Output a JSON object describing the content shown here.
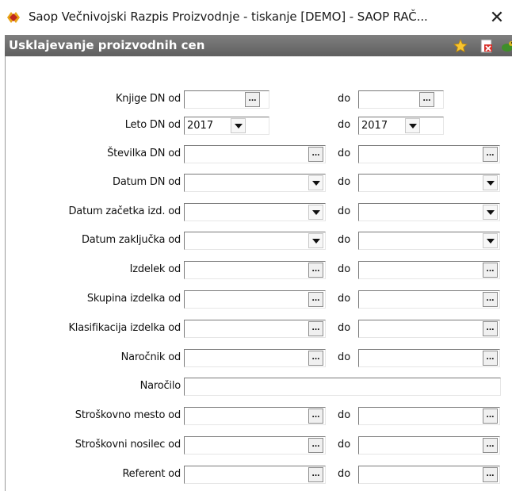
{
  "window": {
    "title": "Saop  Večnivojski Razpis Proizvodnje - tiskanje [DEMO] - SAOP RAČ...",
    "close_glyph": "✕"
  },
  "banner": {
    "title": "Usklajevanje proizvodnih cen",
    "icons": [
      "favorite-star-icon",
      "close-document-icon",
      "exit-turtle-icon"
    ]
  },
  "form": {
    "do_label": "do",
    "rows": [
      {
        "key": "knjige_dn",
        "label": "Knjige DN od",
        "from": "",
        "to": ""
      },
      {
        "key": "leto_dn",
        "label": "Leto DN od",
        "from": "2017",
        "to": "2017"
      },
      {
        "key": "stevilka_dn",
        "label": "Številka DN od",
        "from": "",
        "to": ""
      },
      {
        "key": "datum_dn",
        "label": "Datum DN od",
        "from": "",
        "to": ""
      },
      {
        "key": "datum_zacetka",
        "label": "Datum začetka izd. od",
        "from": "",
        "to": ""
      },
      {
        "key": "datum_zakljucka",
        "label": "Datum zaključka od",
        "from": "",
        "to": ""
      },
      {
        "key": "izdelek",
        "label": "Izdelek od",
        "from": "",
        "to": ""
      },
      {
        "key": "skupina_izdelka",
        "label": "Skupina izdelka od",
        "from": "",
        "to": ""
      },
      {
        "key": "klasifikacija_izdelka",
        "label": "Klasifikacija izdelka od",
        "from": "",
        "to": ""
      },
      {
        "key": "narocnik",
        "label": "Naročnik od",
        "from": "",
        "to": ""
      },
      {
        "key": "narocilo",
        "label": "Naročilo",
        "value": ""
      },
      {
        "key": "stroskovno_mesto",
        "label": "Stroškovno mesto od",
        "from": "",
        "to": ""
      },
      {
        "key": "strosovni_nosilec",
        "label": "Stroškovni nosilec od",
        "from": "",
        "to": ""
      },
      {
        "key": "referent",
        "label": "Referent od",
        "from": "",
        "to": ""
      }
    ]
  },
  "ellipsis_glyph": "..."
}
